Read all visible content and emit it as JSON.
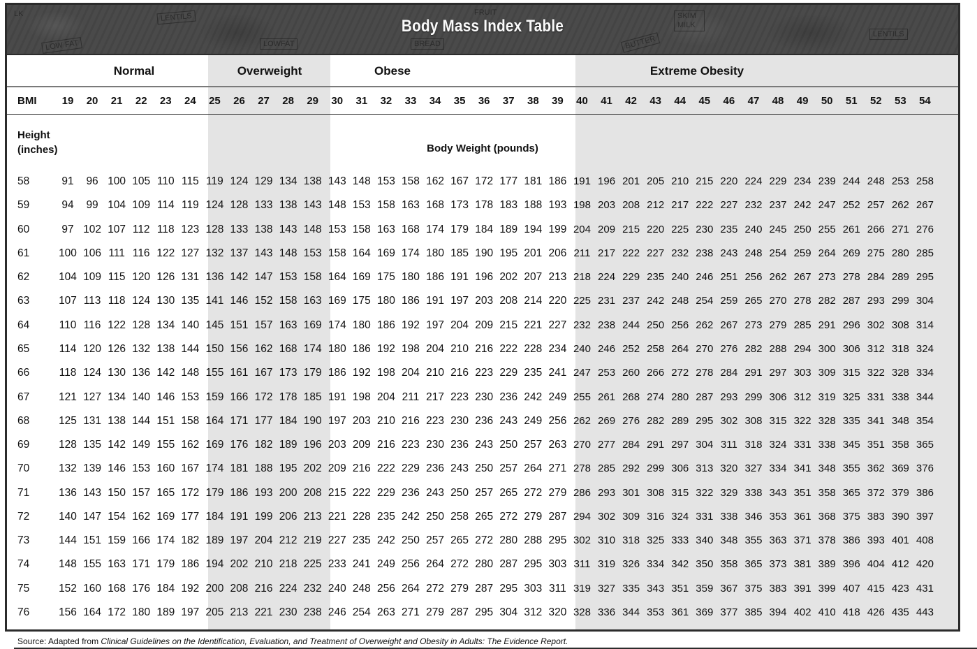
{
  "title": "Body Mass Index Table",
  "banner_doodles": [
    "LOW FAT",
    "LENTILS",
    "LOWFAT",
    "FRUIT",
    "BREAD",
    "BUTTER",
    "SKIM MILK",
    "LENTILS",
    "LK"
  ],
  "categories": [
    {
      "label": "Normal",
      "bmi_range": [
        19,
        24
      ],
      "shaded": false
    },
    {
      "label": "Overweight",
      "bmi_range": [
        25,
        29
      ],
      "shaded": true
    },
    {
      "label": "Obese",
      "bmi_range": [
        30,
        39
      ],
      "shaded": false
    },
    {
      "label": "Extreme Obesity",
      "bmi_range": [
        40,
        54
      ],
      "shaded": true
    }
  ],
  "bmi_label": "BMI",
  "bmi_values": [
    19,
    20,
    21,
    22,
    23,
    24,
    25,
    26,
    27,
    28,
    29,
    30,
    31,
    32,
    33,
    34,
    35,
    36,
    37,
    38,
    39,
    40,
    41,
    42,
    43,
    44,
    45,
    46,
    47,
    48,
    49,
    50,
    51,
    52,
    53,
    54
  ],
  "height_label_line1": "Height",
  "height_label_line2": "(inches)",
  "weight_label": "Body Weight (pounds)",
  "rows": [
    {
      "height": 58,
      "weights": [
        91,
        96,
        100,
        105,
        110,
        115,
        119,
        124,
        129,
        134,
        138,
        143,
        148,
        153,
        158,
        162,
        167,
        172,
        177,
        181,
        186,
        191,
        196,
        201,
        205,
        210,
        215,
        220,
        224,
        229,
        234,
        239,
        244,
        248,
        253,
        258
      ]
    },
    {
      "height": 59,
      "weights": [
        94,
        99,
        104,
        109,
        114,
        119,
        124,
        128,
        133,
        138,
        143,
        148,
        153,
        158,
        163,
        168,
        173,
        178,
        183,
        188,
        193,
        198,
        203,
        208,
        212,
        217,
        222,
        227,
        232,
        237,
        242,
        247,
        252,
        257,
        262,
        267
      ]
    },
    {
      "height": 60,
      "weights": [
        97,
        102,
        107,
        112,
        118,
        123,
        128,
        133,
        138,
        143,
        148,
        153,
        158,
        163,
        168,
        174,
        179,
        184,
        189,
        194,
        199,
        204,
        209,
        215,
        220,
        225,
        230,
        235,
        240,
        245,
        250,
        255,
        261,
        266,
        271,
        276
      ]
    },
    {
      "height": 61,
      "weights": [
        100,
        106,
        111,
        116,
        122,
        127,
        132,
        137,
        143,
        148,
        153,
        158,
        164,
        169,
        174,
        180,
        185,
        190,
        195,
        201,
        206,
        211,
        217,
        222,
        227,
        232,
        238,
        243,
        248,
        254,
        259,
        264,
        269,
        275,
        280,
        285
      ]
    },
    {
      "height": 62,
      "weights": [
        104,
        109,
        115,
        120,
        126,
        131,
        136,
        142,
        147,
        153,
        158,
        164,
        169,
        175,
        180,
        186,
        191,
        196,
        202,
        207,
        213,
        218,
        224,
        229,
        235,
        240,
        246,
        251,
        256,
        262,
        267,
        273,
        278,
        284,
        289,
        295
      ]
    },
    {
      "height": 63,
      "weights": [
        107,
        113,
        118,
        124,
        130,
        135,
        141,
        146,
        152,
        158,
        163,
        169,
        175,
        180,
        186,
        191,
        197,
        203,
        208,
        214,
        220,
        225,
        231,
        237,
        242,
        248,
        254,
        259,
        265,
        270,
        278,
        282,
        287,
        293,
        299,
        304
      ]
    },
    {
      "height": 64,
      "weights": [
        110,
        116,
        122,
        128,
        134,
        140,
        145,
        151,
        157,
        163,
        169,
        174,
        180,
        186,
        192,
        197,
        204,
        209,
        215,
        221,
        227,
        232,
        238,
        244,
        250,
        256,
        262,
        267,
        273,
        279,
        285,
        291,
        296,
        302,
        308,
        314
      ]
    },
    {
      "height": 65,
      "weights": [
        114,
        120,
        126,
        132,
        138,
        144,
        150,
        156,
        162,
        168,
        174,
        180,
        186,
        192,
        198,
        204,
        210,
        216,
        222,
        228,
        234,
        240,
        246,
        252,
        258,
        264,
        270,
        276,
        282,
        288,
        294,
        300,
        306,
        312,
        318,
        324
      ]
    },
    {
      "height": 66,
      "weights": [
        118,
        124,
        130,
        136,
        142,
        148,
        155,
        161,
        167,
        173,
        179,
        186,
        192,
        198,
        204,
        210,
        216,
        223,
        229,
        235,
        241,
        247,
        253,
        260,
        266,
        272,
        278,
        284,
        291,
        297,
        303,
        309,
        315,
        322,
        328,
        334
      ]
    },
    {
      "height": 67,
      "weights": [
        121,
        127,
        134,
        140,
        146,
        153,
        159,
        166,
        172,
        178,
        185,
        191,
        198,
        204,
        211,
        217,
        223,
        230,
        236,
        242,
        249,
        255,
        261,
        268,
        274,
        280,
        287,
        293,
        299,
        306,
        312,
        319,
        325,
        331,
        338,
        344
      ]
    },
    {
      "height": 68,
      "weights": [
        125,
        131,
        138,
        144,
        151,
        158,
        164,
        171,
        177,
        184,
        190,
        197,
        203,
        210,
        216,
        223,
        230,
        236,
        243,
        249,
        256,
        262,
        269,
        276,
        282,
        289,
        295,
        302,
        308,
        315,
        322,
        328,
        335,
        341,
        348,
        354
      ]
    },
    {
      "height": 69,
      "weights": [
        128,
        135,
        142,
        149,
        155,
        162,
        169,
        176,
        182,
        189,
        196,
        203,
        209,
        216,
        223,
        230,
        236,
        243,
        250,
        257,
        263,
        270,
        277,
        284,
        291,
        297,
        304,
        311,
        318,
        324,
        331,
        338,
        345,
        351,
        358,
        365
      ]
    },
    {
      "height": 70,
      "weights": [
        132,
        139,
        146,
        153,
        160,
        167,
        174,
        181,
        188,
        195,
        202,
        209,
        216,
        222,
        229,
        236,
        243,
        250,
        257,
        264,
        271,
        278,
        285,
        292,
        299,
        306,
        313,
        320,
        327,
        334,
        341,
        348,
        355,
        362,
        369,
        376
      ]
    },
    {
      "height": 71,
      "weights": [
        136,
        143,
        150,
        157,
        165,
        172,
        179,
        186,
        193,
        200,
        208,
        215,
        222,
        229,
        236,
        243,
        250,
        257,
        265,
        272,
        279,
        286,
        293,
        301,
        308,
        315,
        322,
        329,
        338,
        343,
        351,
        358,
        365,
        372,
        379,
        386
      ]
    },
    {
      "height": 72,
      "weights": [
        140,
        147,
        154,
        162,
        169,
        177,
        184,
        191,
        199,
        206,
        213,
        221,
        228,
        235,
        242,
        250,
        258,
        265,
        272,
        279,
        287,
        294,
        302,
        309,
        316,
        324,
        331,
        338,
        346,
        353,
        361,
        368,
        375,
        383,
        390,
        397
      ]
    },
    {
      "height": 73,
      "weights": [
        144,
        151,
        159,
        166,
        174,
        182,
        189,
        197,
        204,
        212,
        219,
        227,
        235,
        242,
        250,
        257,
        265,
        272,
        280,
        288,
        295,
        302,
        310,
        318,
        325,
        333,
        340,
        348,
        355,
        363,
        371,
        378,
        386,
        393,
        401,
        408
      ]
    },
    {
      "height": 74,
      "weights": [
        148,
        155,
        163,
        171,
        179,
        186,
        194,
        202,
        210,
        218,
        225,
        233,
        241,
        249,
        256,
        264,
        272,
        280,
        287,
        295,
        303,
        311,
        319,
        326,
        334,
        342,
        350,
        358,
        365,
        373,
        381,
        389,
        396,
        404,
        412,
        420
      ]
    },
    {
      "height": 75,
      "weights": [
        152,
        160,
        168,
        176,
        184,
        192,
        200,
        208,
        216,
        224,
        232,
        240,
        248,
        256,
        264,
        272,
        279,
        287,
        295,
        303,
        311,
        319,
        327,
        335,
        343,
        351,
        359,
        367,
        375,
        383,
        391,
        399,
        407,
        415,
        423,
        431
      ]
    },
    {
      "height": 76,
      "weights": [
        156,
        164,
        172,
        180,
        189,
        197,
        205,
        213,
        221,
        230,
        238,
        246,
        254,
        263,
        271,
        279,
        287,
        295,
        304,
        312,
        320,
        328,
        336,
        344,
        353,
        361,
        369,
        377,
        385,
        394,
        402,
        410,
        418,
        426,
        435,
        443
      ]
    }
  ],
  "source": {
    "prefix": "Source:  Adapted from ",
    "title_italic": "Clinical Guidelines on the Identification, Evaluation, and Treatment of Overweight and Obesity in Adults: The Evidence Report."
  },
  "colors": {
    "banner": "#484848",
    "shaded_band": "#e4e4e4",
    "border": "#2b2b2b"
  }
}
